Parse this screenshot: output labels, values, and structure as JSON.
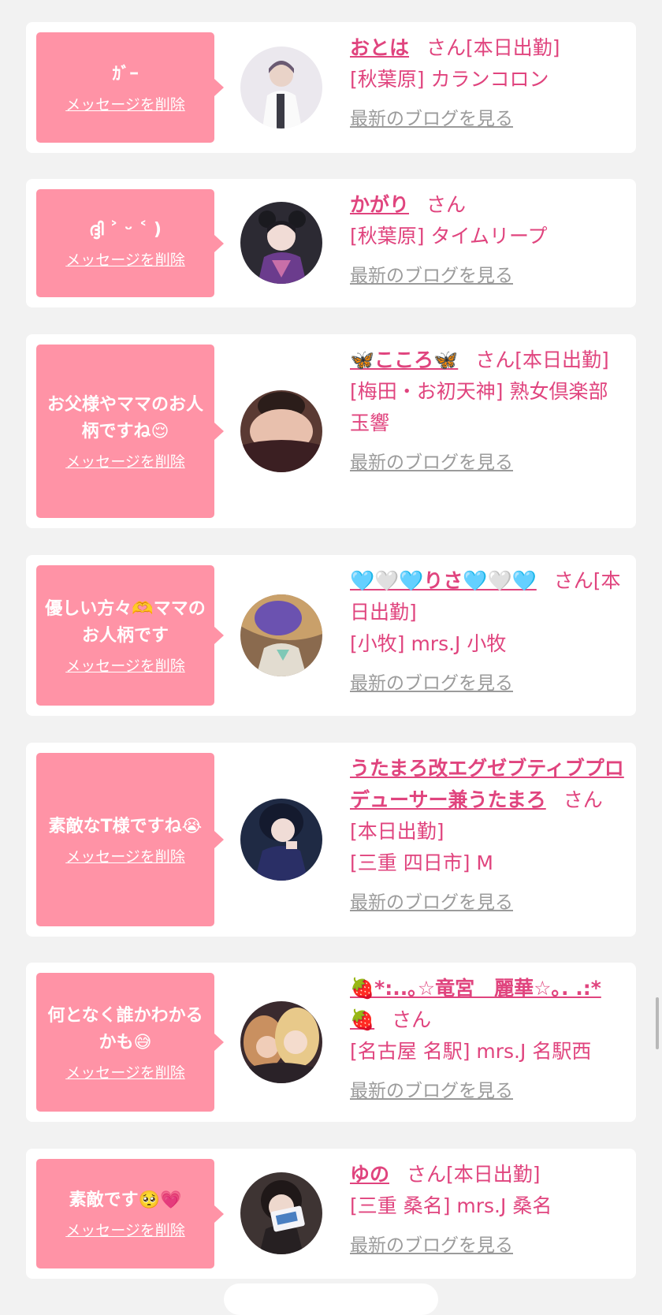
{
  "common": {
    "delete_label": "メッセージを削除",
    "blog_label": "最新のブログを見る",
    "san_label": "さん"
  },
  "colors": {
    "background": "#f2f2f2",
    "bubble": "#ff93a6",
    "accent": "#e0447e",
    "link_gray": "#9b9b9b"
  },
  "cards": [
    {
      "message": "ｶﾞｰ",
      "name": "おとは",
      "status": "[本日出勤]",
      "shop": "[秋葉原] カランコロン",
      "avatar": "avatar-white-dress"
    },
    {
      "message": "ദ്ദി ˃ ᵕ ˂ )",
      "name": "かがり",
      "status": "",
      "shop": "[秋葉原] タイムリープ",
      "avatar": "avatar-purple-kimono"
    },
    {
      "message": "お父様やママのお人柄ですね😌",
      "name": "🦋こころ🦋",
      "status": "[本日出勤]",
      "shop": "[梅田・お初天神] 熟女倶楽部 玉響",
      "avatar": "avatar-dark-top"
    },
    {
      "message": "優しい方々🫶ママのお人柄です",
      "name": "🩵🤍🩵りさ🩵🤍🩵",
      "status": "[本日出勤]",
      "shop": "[小牧] mrs.J 小牧",
      "avatar": "avatar-purple-blur"
    },
    {
      "message": "素敵なT様ですね😭",
      "name": "うたまろ改エグゼブティブプロデューサー兼うたまろ",
      "status": "[本日出勤]",
      "shop": "[三重 四日市] M",
      "avatar": "avatar-navy-dress"
    },
    {
      "message": "何となく誰かわかるかも😅",
      "name": "🍓*:..｡☆竜宮　麗華☆｡. .:*🍓",
      "status": "",
      "shop": "[名古屋 名駅] mrs.J 名駅西",
      "avatar": "avatar-two-women"
    },
    {
      "message": "素敵です🥺💗",
      "name": "ゆの",
      "status": "[本日出勤]",
      "shop": "[三重 桑名] mrs.J 桑名",
      "avatar": "avatar-holding-card"
    }
  ]
}
